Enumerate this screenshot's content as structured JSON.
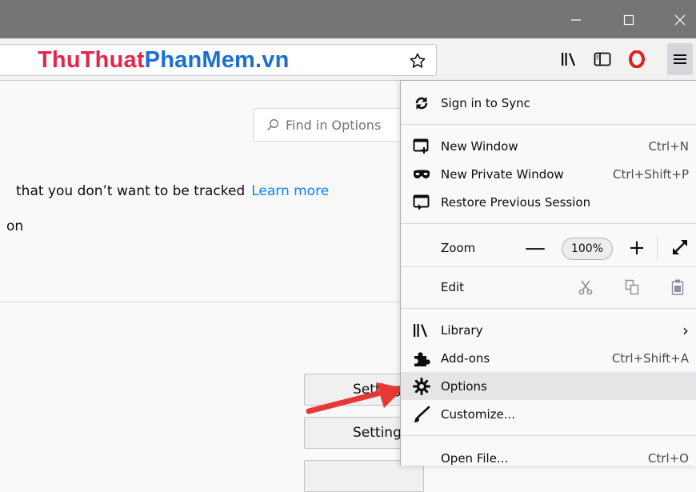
{
  "watermark": {
    "part1": "ThuThuat",
    "part2": "PhanMem",
    "part3": ".vn"
  },
  "window_controls": {
    "minimize": "—",
    "maximize": "☐",
    "close": "✕"
  },
  "page": {
    "find_placeholder": "Find in Options",
    "tracking_text": "that you don’t want to be tracked",
    "learn_more": "Learn more",
    "on_text": "on",
    "settings_button_1": "Settings...",
    "settings_button_2": "Settings..."
  },
  "menu": {
    "sync": "Sign in to Sync",
    "new_window": "New Window",
    "new_window_sc": "Ctrl+N",
    "private_window": "New Private Window",
    "private_window_sc": "Ctrl+Shift+P",
    "restore": "Restore Previous Session",
    "zoom_label": "Zoom",
    "zoom_minus": "—",
    "zoom_value": "100%",
    "zoom_plus": "+",
    "edit_label": "Edit",
    "library": "Library",
    "library_arrow": "›",
    "addons": "Add-ons",
    "addons_sc": "Ctrl+Shift+A",
    "options": "Options",
    "customize": "Customize...",
    "open_file": "Open File...",
    "open_file_sc": "Ctrl+O"
  },
  "colors": {
    "accent": "#0a84ff",
    "arrow": "#e53935",
    "titlebar": "#757575"
  }
}
